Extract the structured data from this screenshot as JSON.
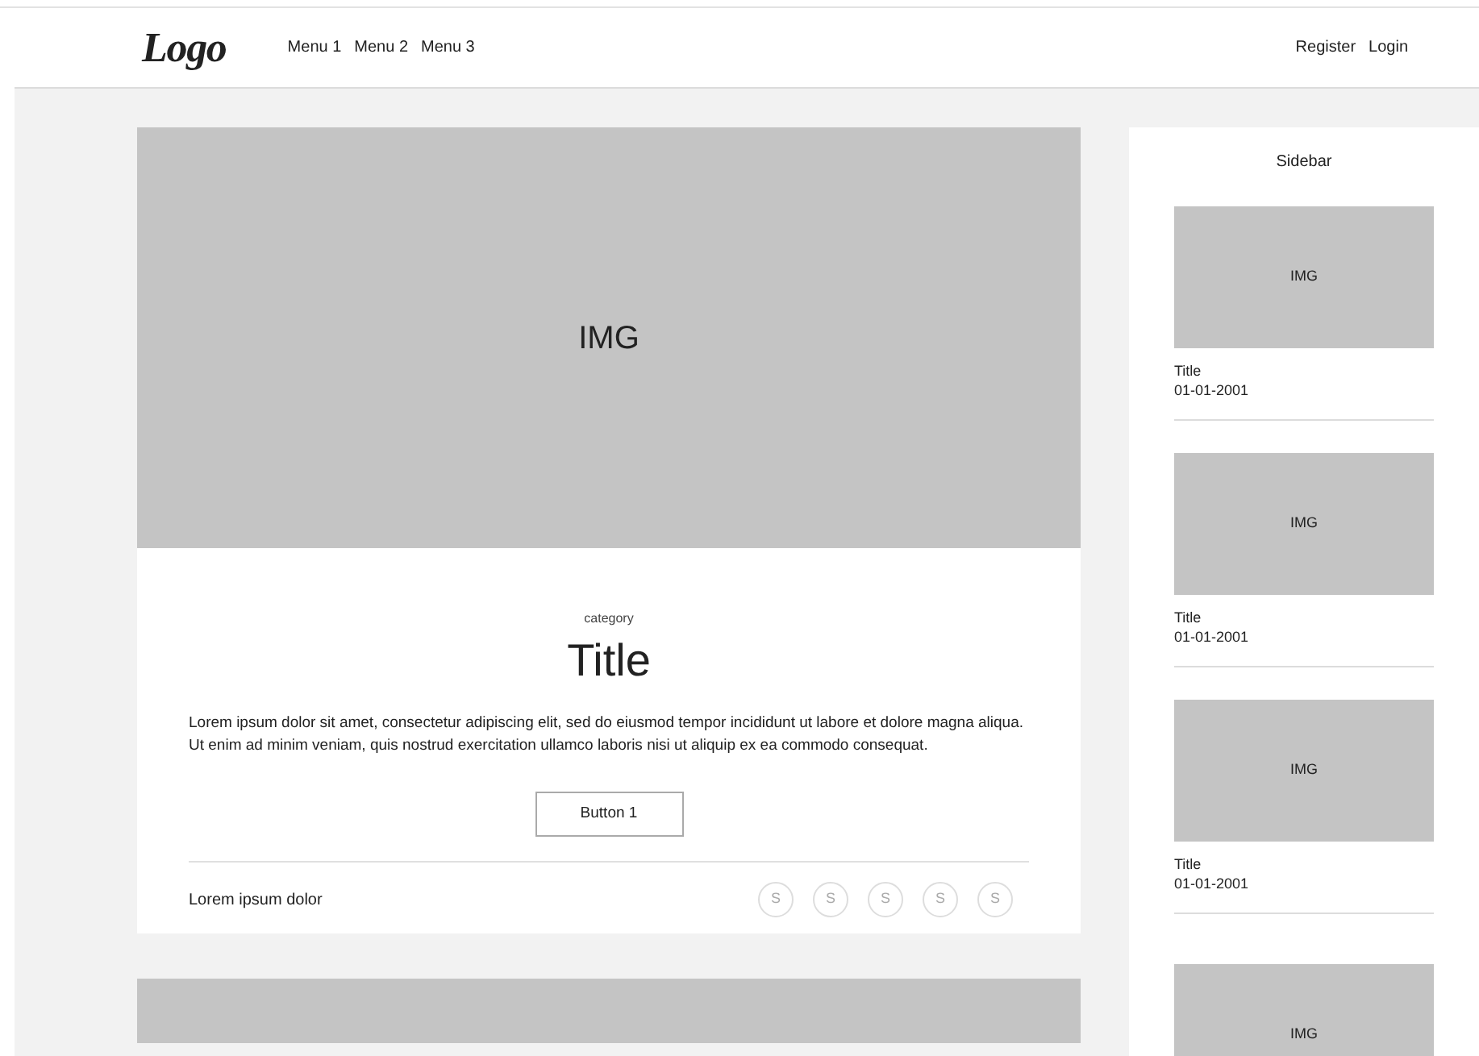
{
  "header": {
    "logo": "Logo",
    "menu": [
      "Menu 1",
      "Menu 2",
      "Menu 3"
    ],
    "actions": [
      "Register",
      "Login"
    ]
  },
  "posts": [
    {
      "image_label": "IMG",
      "category": "category",
      "title": "Title",
      "body": "Lorem ipsum dolor sit amet, consectetur adipiscing elit, sed do eiusmod tempor incididunt ut labore et dolore  magna aliqua. Ut enim ad minim veniam, quis nostrud exercitation ullamco laboris nisi ut aliquip ex ea commodo consequat.",
      "button": "Button 1",
      "footer_text": "Lorem ipsum dolor",
      "share": [
        "S",
        "S",
        "S",
        "S",
        "S"
      ]
    }
  ],
  "sidebar": {
    "title": "Sidebar",
    "items": [
      {
        "image_label": "IMG",
        "title": "Title",
        "date": "01-01-2001"
      },
      {
        "image_label": "IMG",
        "title": "Title",
        "date": "01-01-2001"
      },
      {
        "image_label": "IMG",
        "title": "Title",
        "date": "01-01-2001"
      },
      {
        "image_label": "IMG"
      }
    ]
  }
}
